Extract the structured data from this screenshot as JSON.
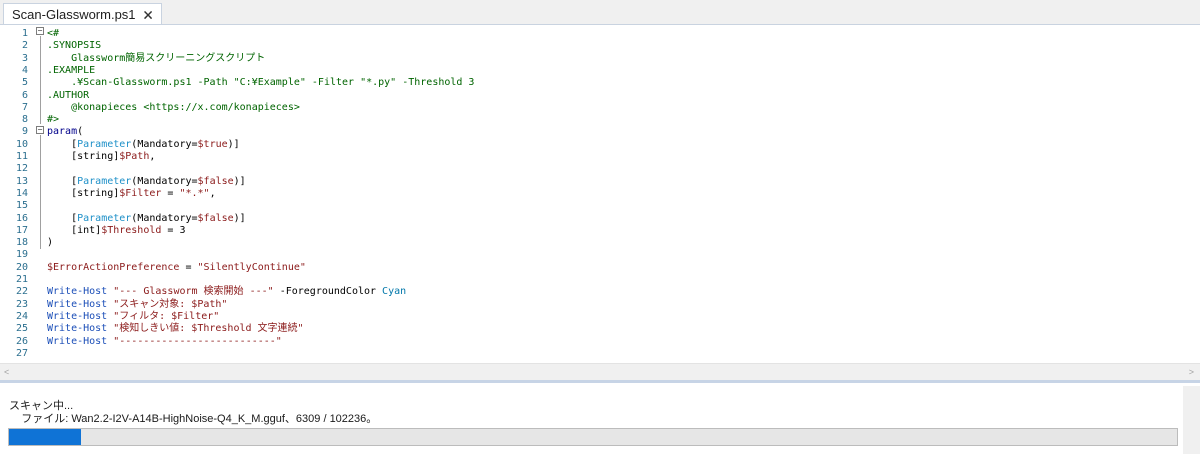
{
  "tab": {
    "title": "Scan-Glassworm.ps1",
    "close_glyph": "🗙"
  },
  "code_lines": [
    {
      "n": "1",
      "parts": [
        [
          "t-comment",
          "<#"
        ]
      ]
    },
    {
      "n": "2",
      "parts": [
        [
          "t-comment",
          ".SYNOPSIS"
        ]
      ]
    },
    {
      "n": "3",
      "parts": [
        [
          "t-comment",
          "    Glassworm簡易スクリーニングスクリプト"
        ]
      ]
    },
    {
      "n": "4",
      "parts": [
        [
          "t-comment",
          ".EXAMPLE"
        ]
      ]
    },
    {
      "n": "5",
      "parts": [
        [
          "t-comment",
          "    .¥Scan-Glassworm.ps1 -Path \"C:¥Example\" -Filter \"*.py\" -Threshold 3"
        ]
      ]
    },
    {
      "n": "6",
      "parts": [
        [
          "t-comment",
          ".AUTHOR"
        ]
      ]
    },
    {
      "n": "7",
      "parts": [
        [
          "t-comment",
          "    @konapieces <https://x.com/konapieces>"
        ]
      ]
    },
    {
      "n": "8",
      "parts": [
        [
          "t-comment",
          "#>"
        ]
      ]
    },
    {
      "n": "9",
      "parts": [
        [
          "t-kw",
          "param"
        ],
        [
          "t-default",
          "("
        ]
      ]
    },
    {
      "n": "10",
      "parts": [
        [
          "t-default",
          "    ["
        ],
        [
          "t-type",
          "Parameter"
        ],
        [
          "t-default",
          "(Mandatory="
        ],
        [
          "t-var",
          "$true"
        ],
        [
          "t-default",
          ")]"
        ]
      ]
    },
    {
      "n": "11",
      "parts": [
        [
          "t-default",
          "    [string]"
        ],
        [
          "t-var",
          "$Path"
        ],
        [
          "t-default",
          ","
        ]
      ]
    },
    {
      "n": "12",
      "parts": []
    },
    {
      "n": "13",
      "parts": [
        [
          "t-default",
          "    ["
        ],
        [
          "t-type",
          "Parameter"
        ],
        [
          "t-default",
          "(Mandatory="
        ],
        [
          "t-var",
          "$false"
        ],
        [
          "t-default",
          ")]"
        ]
      ]
    },
    {
      "n": "14",
      "parts": [
        [
          "t-default",
          "    [string]"
        ],
        [
          "t-var",
          "$Filter"
        ],
        [
          "t-default",
          " = "
        ],
        [
          "t-str",
          "\"*.*\""
        ],
        [
          "t-default",
          ","
        ]
      ]
    },
    {
      "n": "15",
      "parts": []
    },
    {
      "n": "16",
      "parts": [
        [
          "t-default",
          "    ["
        ],
        [
          "t-type",
          "Parameter"
        ],
        [
          "t-default",
          "(Mandatory="
        ],
        [
          "t-var",
          "$false"
        ],
        [
          "t-default",
          ")]"
        ]
      ]
    },
    {
      "n": "17",
      "parts": [
        [
          "t-default",
          "    [int]"
        ],
        [
          "t-var",
          "$Threshold"
        ],
        [
          "t-default",
          " = 3"
        ]
      ]
    },
    {
      "n": "18",
      "parts": [
        [
          "t-default",
          ")"
        ]
      ]
    },
    {
      "n": "19",
      "parts": []
    },
    {
      "n": "20",
      "parts": [
        [
          "t-var",
          "$ErrorActionPreference"
        ],
        [
          "t-default",
          " = "
        ],
        [
          "t-str",
          "\"SilentlyContinue\""
        ]
      ]
    },
    {
      "n": "21",
      "parts": []
    },
    {
      "n": "22",
      "parts": [
        [
          "t-cmd",
          "Write-Host"
        ],
        [
          "t-default",
          " "
        ],
        [
          "t-str",
          "\"--- Glassworm 検索開始 ---\""
        ],
        [
          "t-default",
          " -ForegroundColor "
        ],
        [
          "t-cyan",
          "Cyan"
        ]
      ]
    },
    {
      "n": "23",
      "parts": [
        [
          "t-cmd",
          "Write-Host"
        ],
        [
          "t-default",
          " "
        ],
        [
          "t-str",
          "\"スキャン対象: $Path\""
        ]
      ]
    },
    {
      "n": "24",
      "parts": [
        [
          "t-cmd",
          "Write-Host"
        ],
        [
          "t-default",
          " "
        ],
        [
          "t-str",
          "\"フィルタ: $Filter\""
        ]
      ]
    },
    {
      "n": "25",
      "parts": [
        [
          "t-cmd",
          "Write-Host"
        ],
        [
          "t-default",
          " "
        ],
        [
          "t-str",
          "\"検知しきい値: $Threshold 文字連続\""
        ]
      ]
    },
    {
      "n": "26",
      "parts": [
        [
          "t-cmd",
          "Write-Host"
        ],
        [
          "t-default",
          " "
        ],
        [
          "t-str",
          "\"--------------------------\""
        ]
      ]
    },
    {
      "n": "27",
      "parts": []
    }
  ],
  "output": {
    "status": "スキャン中...",
    "file_line": "    ファイル: Wan2.2-I2V-A14B-HighNoise-Q4_K_M.gguf、6309 / 102236。",
    "progress_fraction": 0.0617
  },
  "colors": {
    "accent": "#0f73d6",
    "comment": "#006400",
    "variable": "#8b1a1a",
    "type": "#1e90c8"
  }
}
